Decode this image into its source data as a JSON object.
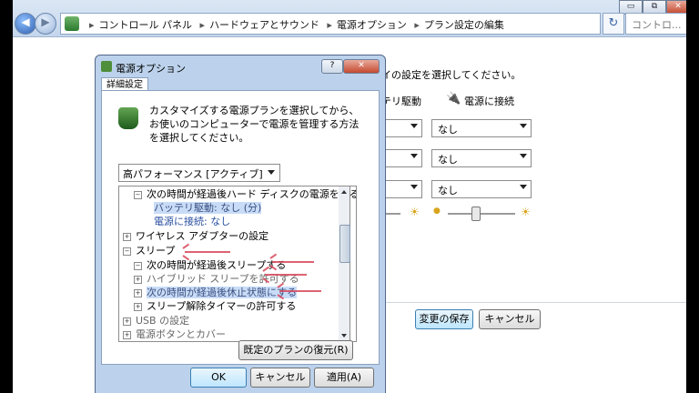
{
  "address": {
    "breadcrumbs": [
      "コントロール パネル",
      "ハードウェアとサウンド",
      "電源オプション",
      "プラン設定の編集"
    ],
    "search_placeholder": "コントロ..."
  },
  "window_controls": {
    "minimize": "▭",
    "maximize": "⧉",
    "close": "✕"
  },
  "background": {
    "heading_partial": "レイの設定を選択してください。",
    "col_battery": "ッテリ駆動",
    "col_plugged": "電源に接続",
    "select_rows": [
      {
        "battery": "",
        "plugged": "なし"
      },
      {
        "battery": "",
        "plugged": "なし"
      },
      {
        "battery": "",
        "plugged": "なし"
      }
    ],
    "save_button": "変更の保存",
    "cancel_button": "キャンセル"
  },
  "dialog": {
    "title": "電源オプション",
    "help_button": "?",
    "close_button": "✕",
    "tab": "詳細設定",
    "description": "カスタマイズする電源プランを選択してから、お使いのコンピューターで電源を管理する方法を選択してください。",
    "plan_select": "高パフォーマンス [アクティブ]",
    "tree": [
      {
        "indent": 1,
        "expander": "⊟",
        "label": "次の時間が経過後ハード ディスクの電源を切る"
      },
      {
        "indent": 2,
        "expander": "",
        "label": "バッテリ駆動: なし (分)",
        "highlight": true
      },
      {
        "indent": 2,
        "expander": "",
        "label": "電源に接続: なし"
      },
      {
        "indent": 0,
        "expander": "⊞",
        "label": "ワイヤレス アダプターの設定"
      },
      {
        "indent": 0,
        "expander": "⊟",
        "label": "スリープ"
      },
      {
        "indent": 1,
        "expander": "⊟",
        "label": "次の時間が経過後スリープする"
      },
      {
        "indent": 1,
        "expander": "⊞",
        "label": "ハイブリッド スリープを許可する"
      },
      {
        "indent": 1,
        "expander": "⊞",
        "label": "次の時間が経過後休止状態にする",
        "highlight": true
      },
      {
        "indent": 1,
        "expander": "⊞",
        "label": "スリープ解除タイマーの許可する"
      },
      {
        "indent": 0,
        "expander": "⊞",
        "label": "USB の設定"
      },
      {
        "indent": 0,
        "expander": "⊞",
        "label": "電源ボタンとカバー"
      }
    ],
    "restore_button": "既定のプランの復元(R)",
    "ok_button": "OK",
    "cancel_button": "キャンセル",
    "apply_button": "適用(A)"
  }
}
